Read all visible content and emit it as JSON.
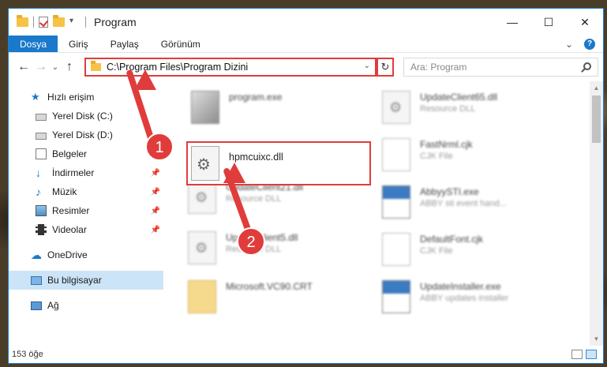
{
  "window": {
    "title": "Program"
  },
  "controls": {
    "minimize": "—",
    "maximize": "☐",
    "close": "✕"
  },
  "ribbon": {
    "tabs": [
      "Dosya",
      "Giriş",
      "Paylaş",
      "Görünüm"
    ],
    "expand": "⌄",
    "help": "?"
  },
  "nav": {
    "back": "←",
    "forward": "→",
    "up": "↑",
    "recent": "⌄"
  },
  "address": {
    "path": "C:\\Program Files\\Program Dizini",
    "dropdown": "⌄",
    "refresh": "↻"
  },
  "search": {
    "placeholder": "Ara: Program"
  },
  "sidebar": {
    "quick_access": "Hızlı erişim",
    "items": [
      {
        "label": "Yerel Disk (C:)",
        "icon": "disk-icon",
        "pinned": false
      },
      {
        "label": "Yerel Disk (D:)",
        "icon": "disk-icon",
        "pinned": false
      },
      {
        "label": "Belgeler",
        "icon": "documents-icon",
        "pinned": true
      },
      {
        "label": "İndirmeler",
        "icon": "download-icon",
        "pinned": true
      },
      {
        "label": "Müzik",
        "icon": "music-icon",
        "pinned": true
      },
      {
        "label": "Resimler",
        "icon": "pictures-icon",
        "pinned": true
      },
      {
        "label": "Videolar",
        "icon": "video-icon",
        "pinned": true
      }
    ],
    "onedrive": "OneDrive",
    "this_pc": "Bu bilgisayar",
    "network": "Ağ"
  },
  "files": {
    "left": [
      {
        "name": "program.exe",
        "type": ""
      },
      {
        "name": "UpdateClient21.dll",
        "type": "Resource DLL"
      },
      {
        "name": "UpdateClient5.dll",
        "type": "Resource DLL"
      },
      {
        "name": "Microsoft.VC90.CRT",
        "type": ""
      }
    ],
    "highlighted": {
      "name": "hpmcuixc.dll"
    },
    "right": [
      {
        "name": "UpdateClient65.dll",
        "type": "Resource DLL"
      },
      {
        "name": "FastNrml.cjk",
        "type": "CJK File"
      },
      {
        "name": "AbbyySTI.exe",
        "type": "ABBY sti event hand..."
      },
      {
        "name": "DefaultFont.cjk",
        "type": "CJK File"
      },
      {
        "name": "UpdateInstaller.exe",
        "type": "ABBY updates installer"
      }
    ]
  },
  "status": {
    "count": "153 öğe"
  },
  "annotations": {
    "step1": "1",
    "step2": "2"
  },
  "colors": {
    "accent": "#1979ca",
    "highlight": "#e03c3c",
    "selected": "#cce4f7"
  }
}
